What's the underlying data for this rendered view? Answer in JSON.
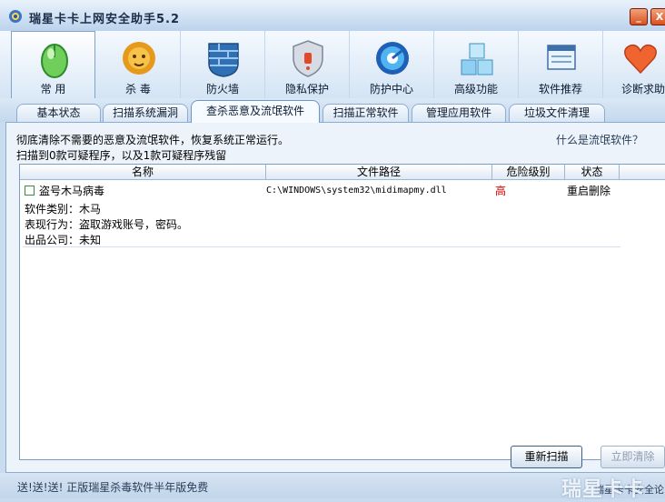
{
  "window": {
    "title": "瑞星卡卡上网安全助手5.2",
    "minimize_glyph": "_",
    "close_glyph": "X"
  },
  "toolbar": {
    "items": [
      {
        "label": "常 用",
        "icon": "mouse-icon"
      },
      {
        "label": "杀 毒",
        "icon": "lion-icon"
      },
      {
        "label": "防火墙",
        "icon": "firewall-icon"
      },
      {
        "label": "隐私保护",
        "icon": "shield-icon"
      },
      {
        "label": "防护中心",
        "icon": "protection-center-icon"
      },
      {
        "label": "高级功能",
        "icon": "blocks-icon"
      },
      {
        "label": "软件推荐",
        "icon": "windows-icon"
      },
      {
        "label": "诊断求助",
        "icon": "heart-icon"
      }
    ]
  },
  "tabs": [
    {
      "label": "基本状态"
    },
    {
      "label": "扫描系统漏洞"
    },
    {
      "label": "查杀恶意及流氓软件"
    },
    {
      "label": "扫描正常软件"
    },
    {
      "label": "管理应用软件"
    },
    {
      "label": "垃圾文件清理"
    }
  ],
  "panel": {
    "description": "彻底清除不需要的恶意及流氓软件，恢复系统正常运行。",
    "help_link": "什么是流氓软件？",
    "scan_summary": "扫描到0款可疑程序，以及1款可疑程序残留"
  },
  "table": {
    "headers": {
      "name": "名称",
      "path": "文件路径",
      "risk": "危险级别",
      "status": "状态"
    },
    "rows": [
      {
        "name": "盗号木马病毒",
        "path": "C:\\WINDOWS\\system32\\midimapmy.dll",
        "risk": "高",
        "status": "重启删除",
        "category": "软件类别：木马",
        "behavior": "表现行为：盗取游戏账号，密码。",
        "publisher": "出品公司：未知"
      }
    ]
  },
  "buttons": {
    "rescan": "重新扫描",
    "clean_now": "立即清除"
  },
  "statusbar": {
    "promo": "送!送!送! 正版瑞星杀毒软件半年版免费",
    "corner_text": "瑞星卡卡安全论",
    "watermark": "瑞星卡卡"
  },
  "colors": {
    "risk_high": "#cc0000",
    "accent": "#7fa3cc"
  }
}
